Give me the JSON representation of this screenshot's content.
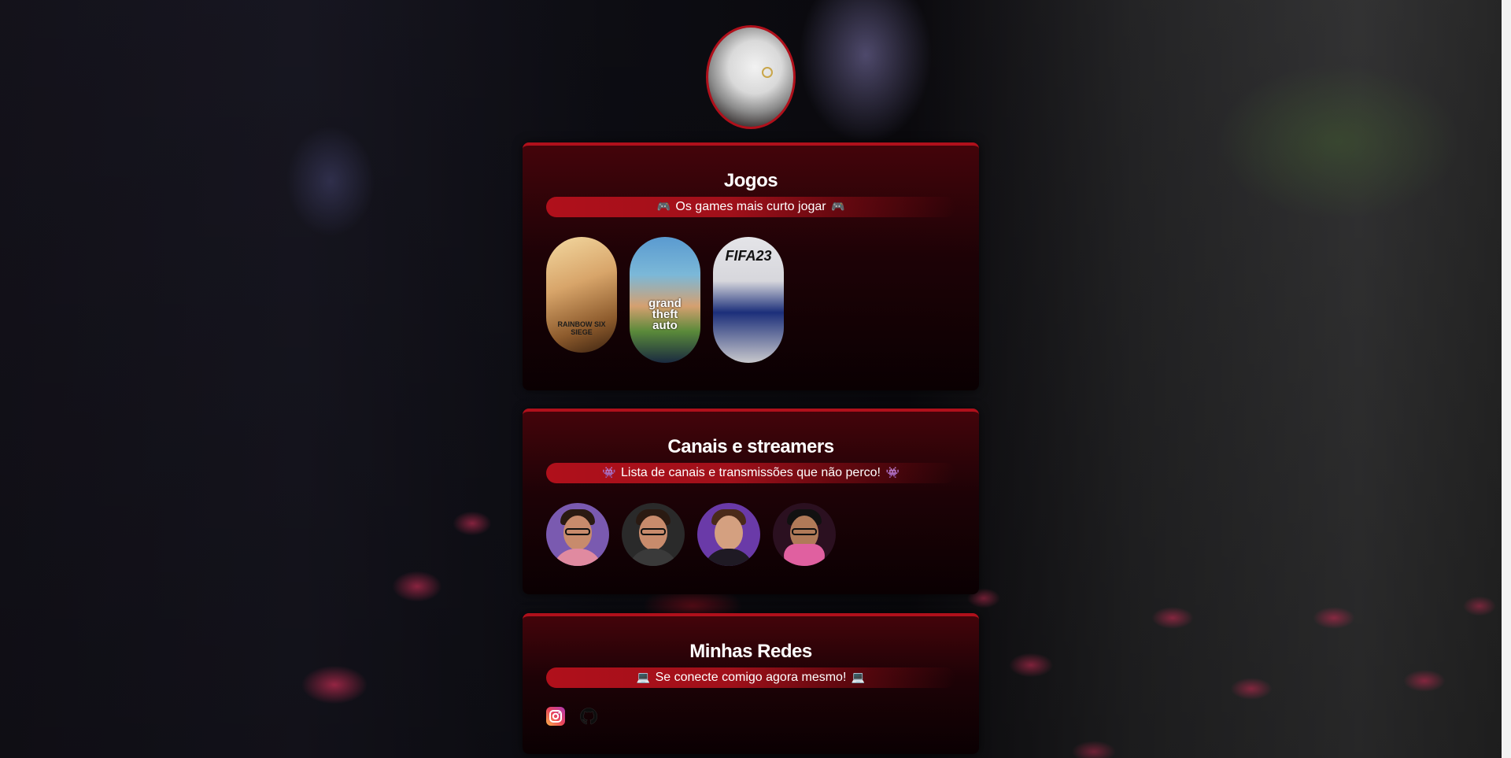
{
  "profile": {
    "avatar_icon": "profile-avatar-real-madrid-shirt"
  },
  "sections": {
    "games": {
      "title": "Jogos",
      "subtitle": "Os games mais curto jogar",
      "subtitle_icon": "gamepad-emoji",
      "items": [
        {
          "name": "Rainbow Six Siege",
          "art_text": "RAINBOW SIX SIEGE"
        },
        {
          "name": "Grand Theft Auto V",
          "art_text": "grand theft auto"
        },
        {
          "name": "FIFA 23",
          "art_text": "FIFA23"
        }
      ]
    },
    "streamers": {
      "title": "Canais e streamers",
      "subtitle": "Lista de canais e transmissões que não perco!",
      "subtitle_icon": "alien-monster-emoji",
      "items": [
        {
          "name": "streamer-1"
        },
        {
          "name": "streamer-2"
        },
        {
          "name": "streamer-3"
        },
        {
          "name": "streamer-4"
        }
      ]
    },
    "socials": {
      "title": "Minhas Redes",
      "subtitle": "Se conecte comigo agora mesmo!",
      "subtitle_icon": "laptop-emoji",
      "items": [
        {
          "name": "instagram",
          "icon": "instagram-icon"
        },
        {
          "name": "github",
          "icon": "github-icon"
        }
      ]
    }
  },
  "colors": {
    "accent": "#b0101b",
    "card_bg_top": "#46040a",
    "card_bg_bottom": "#0a0002",
    "text": "#ffffff"
  }
}
